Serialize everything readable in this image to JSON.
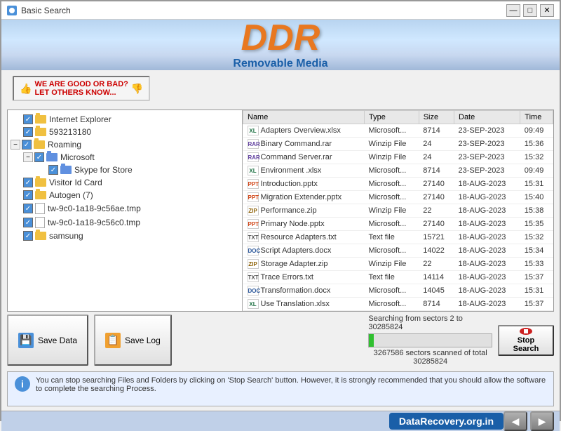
{
  "titlebar": {
    "title": "Basic Search",
    "minimize": "—",
    "maximize": "□",
    "close": "✕"
  },
  "header": {
    "logo": "DDR",
    "subtitle": "Removable Media"
  },
  "banner": {
    "text1": "WE ARE GOOD OR BAD?",
    "text2": "LET OTHERS KNOW..."
  },
  "tree": {
    "items": [
      {
        "id": "internet-explorer",
        "label": "Internet Explorer",
        "depth": 1,
        "checked": true,
        "type": "folder",
        "expandable": false
      },
      {
        "id": "593213180",
        "label": "593213180",
        "depth": 1,
        "checked": true,
        "type": "folder",
        "expandable": false
      },
      {
        "id": "roaming",
        "label": "Roaming",
        "depth": 1,
        "checked": true,
        "type": "folder",
        "expandable": true,
        "expanded": true
      },
      {
        "id": "microsoft",
        "label": "Microsoft",
        "depth": 2,
        "checked": true,
        "type": "folder-blue",
        "expandable": true,
        "expanded": true
      },
      {
        "id": "skype-for-store",
        "label": "Skype for Store",
        "depth": 3,
        "checked": true,
        "type": "folder-blue",
        "expandable": false
      },
      {
        "id": "visitor-id-card",
        "label": "Visitor Id Card",
        "depth": 1,
        "checked": true,
        "type": "folder",
        "expandable": false
      },
      {
        "id": "autogen7",
        "label": "Autogen (7)",
        "depth": 1,
        "checked": true,
        "type": "folder",
        "expandable": false
      },
      {
        "id": "tw1",
        "label": "tw-9c0-1a18-9c56ae.tmp",
        "depth": 1,
        "checked": true,
        "type": "file",
        "expandable": false
      },
      {
        "id": "tw2",
        "label": "tw-9c0-1a18-9c56c0.tmp",
        "depth": 1,
        "checked": true,
        "type": "file",
        "expandable": false
      },
      {
        "id": "samsung",
        "label": "samsung",
        "depth": 1,
        "checked": true,
        "type": "folder",
        "expandable": false
      }
    ]
  },
  "files": {
    "columns": [
      "Name",
      "Type",
      "Size",
      "Date",
      "Time"
    ],
    "rows": [
      {
        "name": "Adapters Overview.xlsx",
        "type": "Microsoft...",
        "size": "8714",
        "date": "23-SEP-2023",
        "time": "09:49",
        "icon": "xl"
      },
      {
        "name": "Binary Command.rar",
        "type": "Winzip File",
        "size": "24",
        "date": "23-SEP-2023",
        "time": "15:36",
        "icon": "rar"
      },
      {
        "name": "Command Server.rar",
        "type": "Winzip File",
        "size": "24",
        "date": "23-SEP-2023",
        "time": "15:32",
        "icon": "rar"
      },
      {
        "name": "Environment .xlsx",
        "type": "Microsoft...",
        "size": "8714",
        "date": "23-SEP-2023",
        "time": "09:49",
        "icon": "xl"
      },
      {
        "name": "Introduction.pptx",
        "type": "Microsoft...",
        "size": "27140",
        "date": "18-AUG-2023",
        "time": "15:31",
        "icon": "ppt"
      },
      {
        "name": "Migration Extender.pptx",
        "type": "Microsoft...",
        "size": "27140",
        "date": "18-AUG-2023",
        "time": "15:40",
        "icon": "ppt"
      },
      {
        "name": "Performance.zip",
        "type": "Winzip File",
        "size": "22",
        "date": "18-AUG-2023",
        "time": "15:38",
        "icon": "zip"
      },
      {
        "name": "Primary Node.pptx",
        "type": "Microsoft...",
        "size": "27140",
        "date": "18-AUG-2023",
        "time": "15:35",
        "icon": "ppt"
      },
      {
        "name": "Resource Adapters.txt",
        "type": "Text file",
        "size": "15721",
        "date": "18-AUG-2023",
        "time": "15:32",
        "icon": "txt"
      },
      {
        "name": "Script Adapters.docx",
        "type": "Microsoft...",
        "size": "14022",
        "date": "18-AUG-2023",
        "time": "15:34",
        "icon": "doc"
      },
      {
        "name": "Storage Adapter.zip",
        "type": "Winzip File",
        "size": "22",
        "date": "18-AUG-2023",
        "time": "15:33",
        "icon": "zip"
      },
      {
        "name": "Trace Errors.txt",
        "type": "Text file",
        "size": "14114",
        "date": "18-AUG-2023",
        "time": "15:37",
        "icon": "txt"
      },
      {
        "name": "Transformation.docx",
        "type": "Microsoft...",
        "size": "14045",
        "date": "18-AUG-2023",
        "time": "15:31",
        "icon": "doc"
      },
      {
        "name": "Use Translation.xlsx",
        "type": "Microsoft...",
        "size": "8714",
        "date": "18-AUG-2023",
        "time": "15:37",
        "icon": "xl"
      }
    ]
  },
  "buttons": {
    "save_data": "Save Data",
    "save_log": "Save Log",
    "stop_search": "Stop\nSearch"
  },
  "progress": {
    "text": "Searching from sectors   2 to 30285824",
    "sectors_text": "3267586  sectors scanned of total 30285824",
    "percent": 4
  },
  "info": {
    "text": "You can stop searching Files and Folders by clicking on 'Stop Search' button. However, it is strongly recommended that you should allow the software to complete the searching Process."
  },
  "footer": {
    "brand": "DataRecovery.org.in"
  }
}
